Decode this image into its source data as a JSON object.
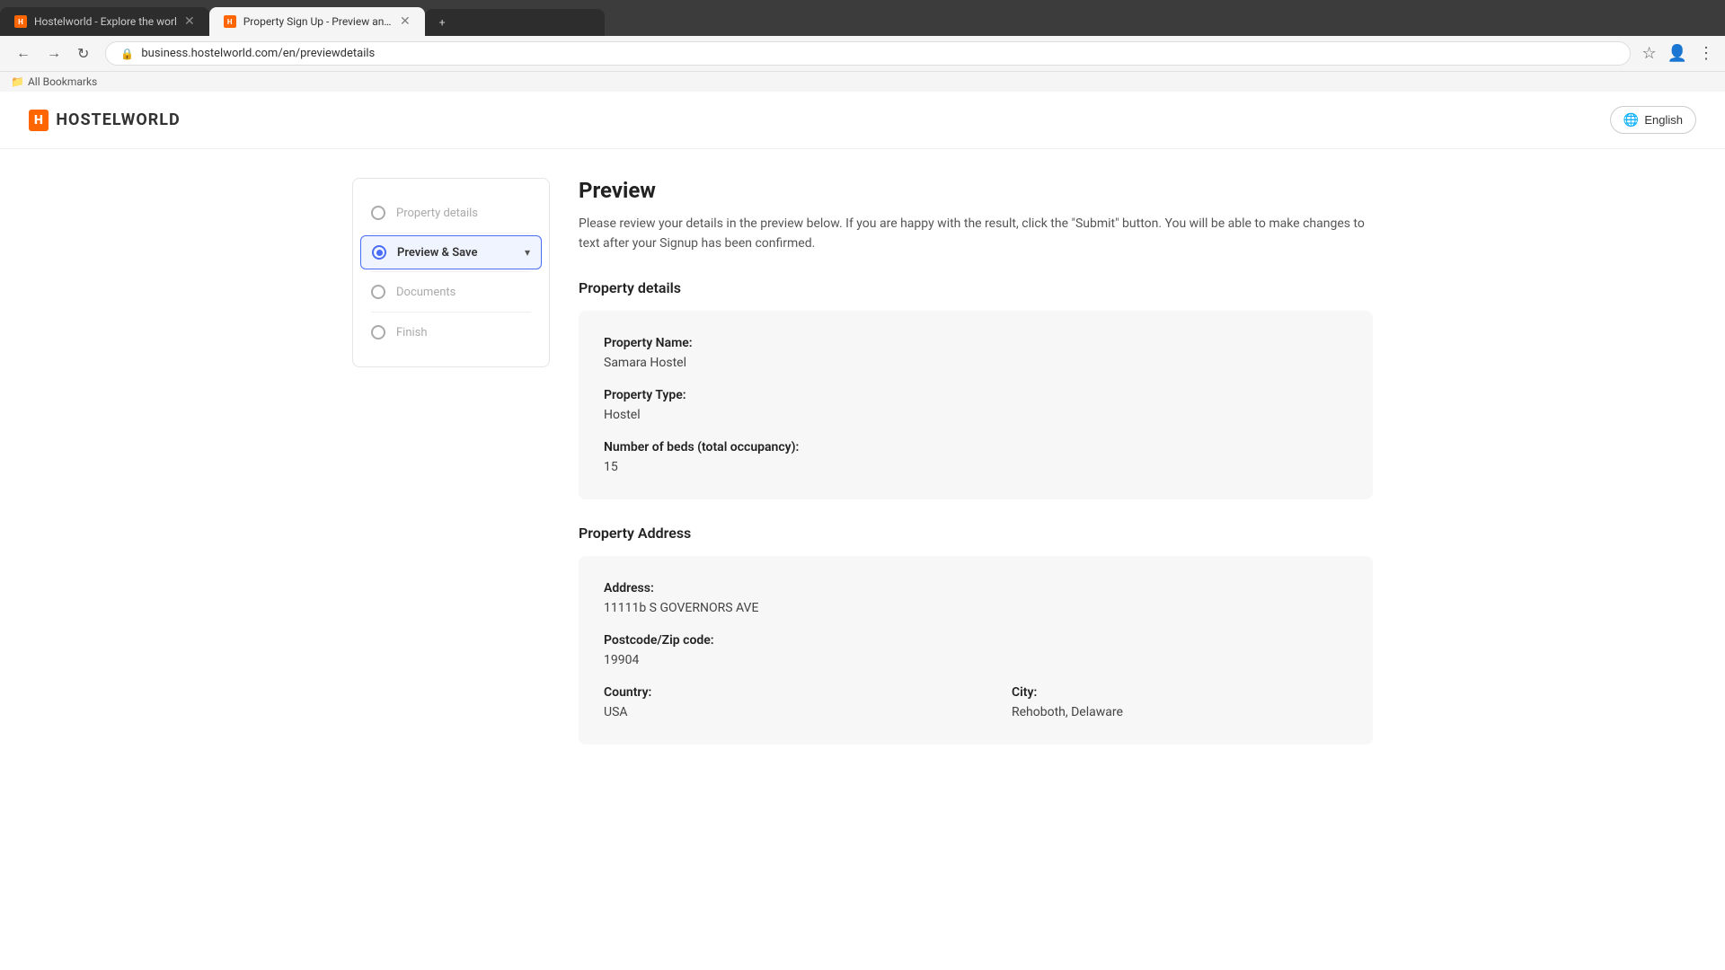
{
  "browser": {
    "tabs": [
      {
        "id": "tab1",
        "favicon": "HW",
        "faviconClass": "hw",
        "title": "Hostelworld - Explore the worl",
        "active": false
      },
      {
        "id": "tab2",
        "favicon": "HW",
        "faviconClass": "hw",
        "title": "Property Sign Up - Preview and...",
        "active": true
      }
    ],
    "new_tab_label": "+",
    "url": "business.hostelworld.com/en/previewdetails",
    "bookmarks_label": "All Bookmarks"
  },
  "header": {
    "logo_text": "HOSTELWORLD",
    "logo_box_text": "H",
    "language_button": "English"
  },
  "sidebar": {
    "items": [
      {
        "id": "property-details",
        "label": "Property details",
        "state": "done"
      },
      {
        "id": "preview-save",
        "label": "Preview & Save",
        "state": "active"
      },
      {
        "id": "documents",
        "label": "Documents",
        "state": "inactive"
      },
      {
        "id": "finish",
        "label": "Finish",
        "state": "inactive"
      }
    ]
  },
  "preview": {
    "title": "Preview",
    "description": "Please review your details in the preview below. If you are happy with the result, click the \"Submit\" button. You will be able to make changes to text after your Signup has been confirmed.",
    "property_details": {
      "section_title": "Property details",
      "fields": [
        {
          "label": "Property Name:",
          "value": "Samara Hostel"
        },
        {
          "label": "Property Type:",
          "value": "Hostel"
        },
        {
          "label": "Number of beds (total occupancy):",
          "value": "15"
        }
      ]
    },
    "property_address": {
      "section_title": "Property Address",
      "fields": [
        {
          "label": "Address:",
          "value": "11111b S GOVERNORS AVE"
        },
        {
          "label": "Postcode/Zip code:",
          "value": "19904"
        }
      ],
      "row_fields": [
        {
          "label": "Country:",
          "value": "USA"
        },
        {
          "label": "City:",
          "value": "Rehoboth, Delaware"
        }
      ]
    }
  }
}
